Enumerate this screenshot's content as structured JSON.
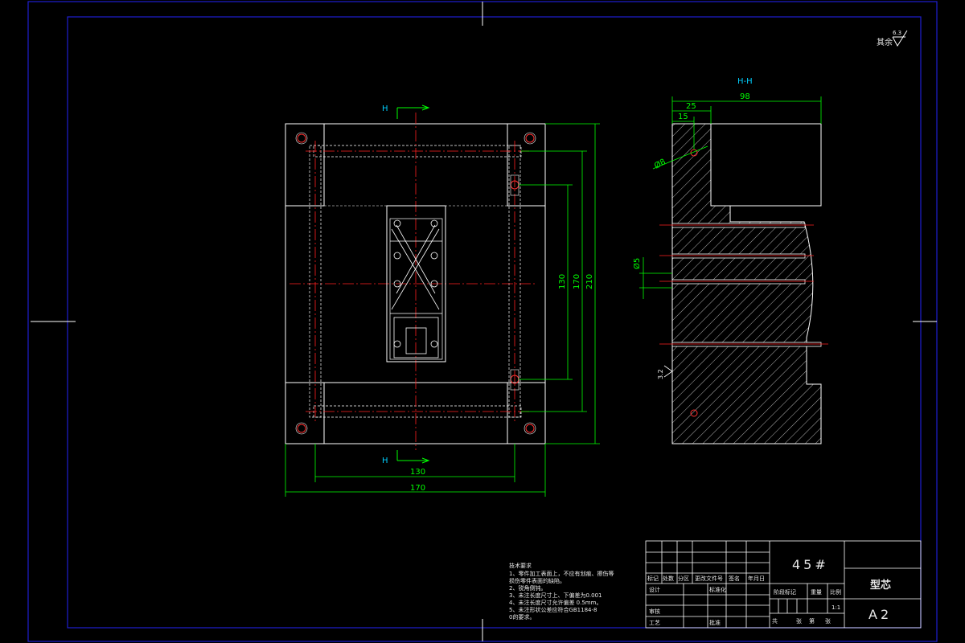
{
  "colors": {
    "background": "#000000",
    "frame": "#1f1fd0",
    "outline": "#ffffff",
    "centerline": "#ff2020",
    "dimension": "#00ff00",
    "dimension_text": "#00d0ff",
    "hole": "#ff3030"
  },
  "roughness": {
    "label": "其余",
    "value": "6.3"
  },
  "front_view": {
    "section_mark_top": "H",
    "section_mark_bottom": "H",
    "dim_width_inner": "130",
    "dim_width_outer": "170",
    "dim_height_1": "130",
    "dim_height_2": "170",
    "dim_height_3": "210"
  },
  "section_view": {
    "title": "H-H",
    "dim_total": "98",
    "dim_25": "25",
    "dim_15": "15",
    "dim_hole_8": "Ø8",
    "dim_hole_5": "Ø5",
    "roughness_side": "3.2"
  },
  "technical_notes": {
    "title": "技术要求",
    "lines": [
      "1、零件加工表面上，不应有划痕、擦伤等",
      "   损伤零件表面的缺陷。",
      "2、锐角倒钝。",
      "3、未注长度尺寸上、下偏差为0.001",
      "4、未注长度尺寸允许偏差 0.5mm。",
      "5、未注形状公差应符合GB1184-8",
      "   0的要求。"
    ]
  },
  "title_block": {
    "material": "45#",
    "part_name": "型芯",
    "sheet_size": "A2",
    "scale_value": "1:1",
    "labels": {
      "biaoji": "标记",
      "chushu": "处数",
      "fenqu": "分区",
      "gengai": "更改文件号",
      "qianming": "签名",
      "nianyueri": "年月日",
      "sheji": "设计",
      "biaozhunhua": "标准化",
      "shenhe": "审核",
      "gongyi": "工艺",
      "pizhun": "批准",
      "jieduan": "阶段标记",
      "zhongliang": "重量",
      "bili": "比例",
      "gong": "共",
      "zhang": "张",
      "di": "第",
      "zhang2": "张"
    }
  }
}
